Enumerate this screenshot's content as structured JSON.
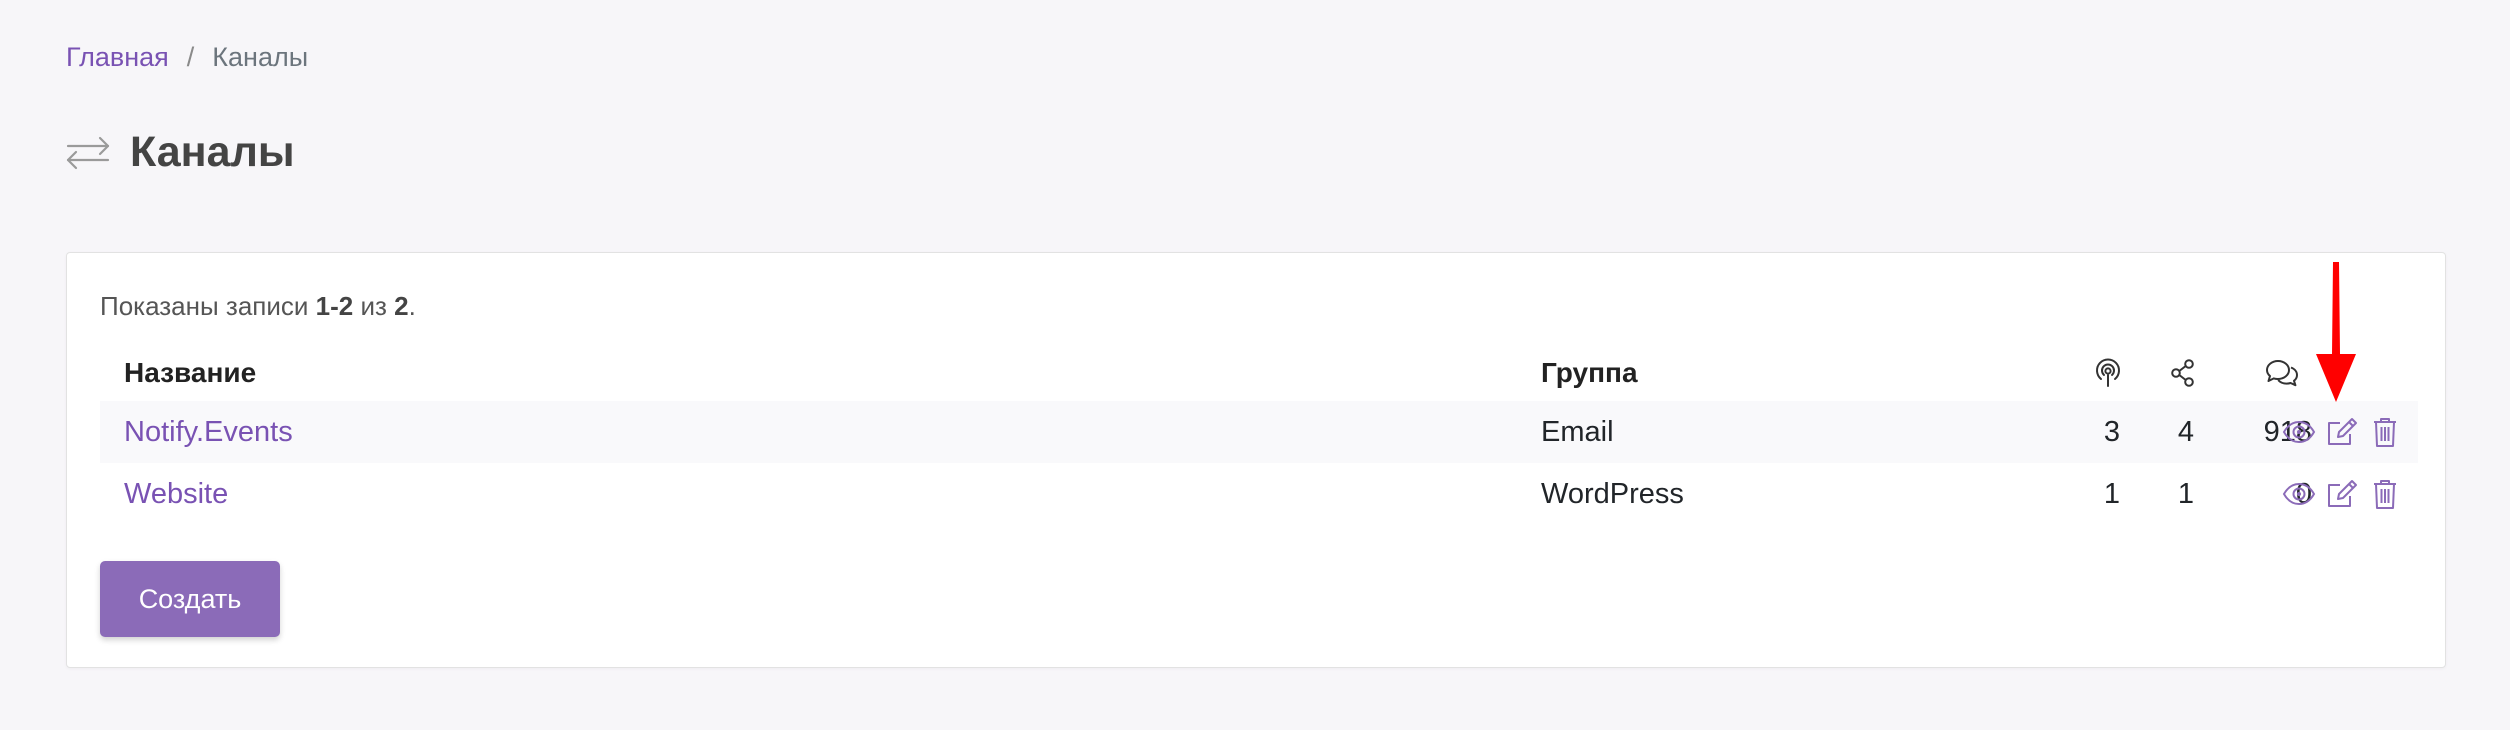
{
  "breadcrumb": {
    "home": "Главная",
    "separator": "/",
    "current": "Каналы"
  },
  "page": {
    "title": "Каналы",
    "title_icon": "exchange-arrows-icon"
  },
  "summary": {
    "prefix": "Показаны записи ",
    "range": "1-2",
    "middle": " из ",
    "total": "2",
    "suffix": "."
  },
  "table": {
    "columns": {
      "name": "Название",
      "group": "Группа",
      "sources_icon": "podcast-icon",
      "recipients_icon": "share-icon",
      "messages_icon": "comments-icon"
    },
    "rows": [
      {
        "name": "Notify.Events",
        "group": "Email",
        "sources": "3",
        "recipients": "4",
        "messages": "918"
      },
      {
        "name": "Website",
        "group": "WordPress",
        "sources": "1",
        "recipients": "1",
        "messages": "0"
      }
    ],
    "action_icons": [
      "eye-icon",
      "edit-icon",
      "trash-icon"
    ]
  },
  "buttons": {
    "create": "Создать"
  },
  "colors": {
    "accent": "#7952b3",
    "button": "#8b6bb8",
    "annotation_arrow": "#ff0000",
    "background": "#f7f6f9"
  }
}
